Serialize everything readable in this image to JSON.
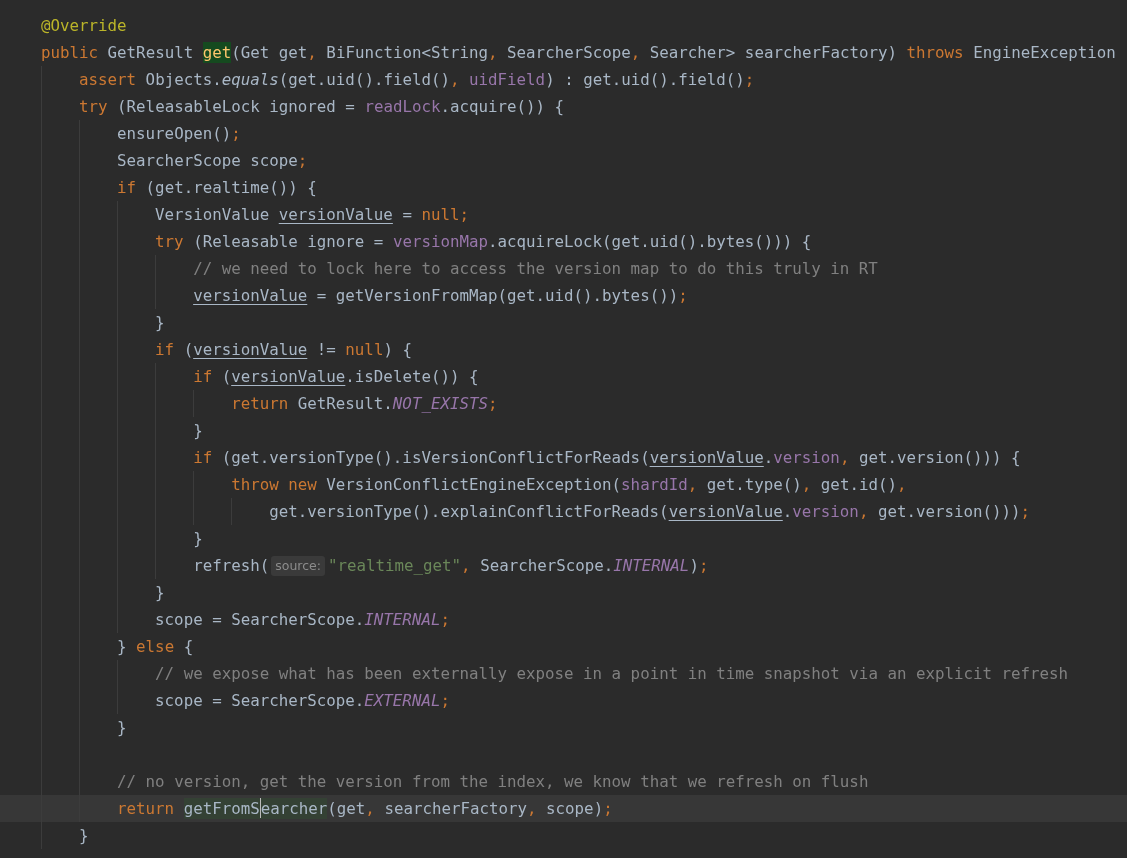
{
  "lines": [
    {
      "current": false,
      "tokens": [
        {
          "kind": "ann",
          "text": "@Override"
        }
      ]
    },
    {
      "current": false,
      "tokens": [
        {
          "kind": "kw",
          "text": "public"
        },
        {
          "kind": "plain",
          "text": " GetResult "
        },
        {
          "kind": "decl",
          "text": "get"
        },
        {
          "kind": "plain",
          "text": "(Get get"
        },
        {
          "kind": "punct",
          "text": ","
        },
        {
          "kind": "plain",
          "text": " BiFunction<String"
        },
        {
          "kind": "punct",
          "text": ","
        },
        {
          "kind": "plain",
          "text": " SearcherScope"
        },
        {
          "kind": "punct",
          "text": ","
        },
        {
          "kind": "plain",
          "text": " Searcher> searcherFactory) "
        },
        {
          "kind": "kw",
          "text": "throws"
        },
        {
          "kind": "plain",
          "text": " EngineException"
        }
      ],
      "children": [
        {
          "current": false,
          "tokens": [
            {
              "kind": "kw",
              "text": "assert"
            },
            {
              "kind": "plain",
              "text": " Objects."
            },
            {
              "kind": "italic",
              "text": "equals"
            },
            {
              "kind": "plain",
              "text": "(get.uid().field()"
            },
            {
              "kind": "punct",
              "text": ", "
            },
            {
              "kind": "field",
              "text": "uidField"
            },
            {
              "kind": "plain",
              "text": ") : get.uid().field()"
            },
            {
              "kind": "punct",
              "text": ";"
            }
          ]
        },
        {
          "current": false,
          "tokens": [
            {
              "kind": "kw",
              "text": "try"
            },
            {
              "kind": "plain",
              "text": " (ReleasableLock ignored = "
            },
            {
              "kind": "field",
              "text": "readLock"
            },
            {
              "kind": "plain",
              "text": ".acquire()) {"
            }
          ],
          "children": [
            {
              "current": false,
              "tokens": [
                {
                  "kind": "plain",
                  "text": "ensureOpen()"
                },
                {
                  "kind": "punct",
                  "text": ";"
                }
              ]
            },
            {
              "current": false,
              "tokens": [
                {
                  "kind": "plain",
                  "text": "SearcherScope scope"
                },
                {
                  "kind": "punct",
                  "text": ";"
                }
              ]
            },
            {
              "current": false,
              "tokens": [
                {
                  "kind": "kw",
                  "text": "if"
                },
                {
                  "kind": "plain",
                  "text": " (get.realtime()) {"
                }
              ],
              "children": [
                {
                  "current": false,
                  "tokens": [
                    {
                      "kind": "plain",
                      "text": "VersionValue "
                    },
                    {
                      "kind": "var",
                      "text": "versionValue"
                    },
                    {
                      "kind": "plain",
                      "text": " = "
                    },
                    {
                      "kind": "kw",
                      "text": "null"
                    },
                    {
                      "kind": "punct",
                      "text": ";"
                    }
                  ]
                },
                {
                  "current": false,
                  "tokens": [
                    {
                      "kind": "kw",
                      "text": "try"
                    },
                    {
                      "kind": "plain",
                      "text": " (Releasable ignore = "
                    },
                    {
                      "kind": "field",
                      "text": "versionMap"
                    },
                    {
                      "kind": "plain",
                      "text": ".acquireLock(get.uid().bytes())) {"
                    }
                  ],
                  "children": [
                    {
                      "current": false,
                      "tokens": [
                        {
                          "kind": "comment",
                          "text": "// we need to lock here to access the version map to do this truly in RT"
                        }
                      ]
                    },
                    {
                      "current": false,
                      "tokens": [
                        {
                          "kind": "var",
                          "text": "versionValue"
                        },
                        {
                          "kind": "plain",
                          "text": " = getVersionFromMap(get.uid().bytes())"
                        },
                        {
                          "kind": "punct",
                          "text": ";"
                        }
                      ]
                    }
                  ]
                },
                {
                  "current": false,
                  "tokens": [
                    {
                      "kind": "plain",
                      "text": "}"
                    }
                  ]
                },
                {
                  "current": false,
                  "tokens": [
                    {
                      "kind": "kw",
                      "text": "if"
                    },
                    {
                      "kind": "plain",
                      "text": " ("
                    },
                    {
                      "kind": "var",
                      "text": "versionValue"
                    },
                    {
                      "kind": "plain",
                      "text": " != "
                    },
                    {
                      "kind": "kw",
                      "text": "null"
                    },
                    {
                      "kind": "plain",
                      "text": ") {"
                    }
                  ],
                  "children": [
                    {
                      "current": false,
                      "tokens": [
                        {
                          "kind": "kw",
                          "text": "if"
                        },
                        {
                          "kind": "plain",
                          "text": " ("
                        },
                        {
                          "kind": "var",
                          "text": "versionValue"
                        },
                        {
                          "kind": "plain",
                          "text": ".isDelete()) {"
                        }
                      ],
                      "children": [
                        {
                          "current": false,
                          "tokens": [
                            {
                              "kind": "kw",
                              "text": "return"
                            },
                            {
                              "kind": "plain",
                              "text": " GetResult."
                            },
                            {
                              "kind": "const",
                              "text": "NOT_EXISTS"
                            },
                            {
                              "kind": "punct",
                              "text": ";"
                            }
                          ]
                        }
                      ]
                    },
                    {
                      "current": false,
                      "tokens": [
                        {
                          "kind": "plain",
                          "text": "}"
                        }
                      ]
                    },
                    {
                      "current": false,
                      "tokens": [
                        {
                          "kind": "kw",
                          "text": "if"
                        },
                        {
                          "kind": "plain",
                          "text": " (get.versionType().isVersionConflictForReads("
                        },
                        {
                          "kind": "var",
                          "text": "versionValue"
                        },
                        {
                          "kind": "plain",
                          "text": "."
                        },
                        {
                          "kind": "field",
                          "text": "version"
                        },
                        {
                          "kind": "punct",
                          "text": ","
                        },
                        {
                          "kind": "plain",
                          "text": " get.version())) {"
                        }
                      ],
                      "children": [
                        {
                          "current": false,
                          "tokens": [
                            {
                              "kind": "kw",
                              "text": "throw new"
                            },
                            {
                              "kind": "plain",
                              "text": " VersionConflictEngineException("
                            },
                            {
                              "kind": "field",
                              "text": "shardId"
                            },
                            {
                              "kind": "punct",
                              "text": ","
                            },
                            {
                              "kind": "plain",
                              "text": " get.type()"
                            },
                            {
                              "kind": "punct",
                              "text": ","
                            },
                            {
                              "kind": "plain",
                              "text": " get.id()"
                            },
                            {
                              "kind": "punct",
                              "text": ","
                            }
                          ],
                          "children": [
                            {
                              "current": false,
                              "tokens": [
                                {
                                  "kind": "plain",
                                  "text": "get.versionType().explainConflictForReads("
                                },
                                {
                                  "kind": "var",
                                  "text": "versionValue"
                                },
                                {
                                  "kind": "plain",
                                  "text": "."
                                },
                                {
                                  "kind": "field",
                                  "text": "version"
                                },
                                {
                                  "kind": "punct",
                                  "text": ","
                                },
                                {
                                  "kind": "plain",
                                  "text": " get.version()))"
                                },
                                {
                                  "kind": "punct",
                                  "text": ";"
                                }
                              ]
                            }
                          ]
                        }
                      ]
                    },
                    {
                      "current": false,
                      "tokens": [
                        {
                          "kind": "plain",
                          "text": "}"
                        }
                      ]
                    },
                    {
                      "current": false,
                      "tokens": [
                        {
                          "kind": "plain",
                          "text": "refresh("
                        },
                        {
                          "kind": "hint",
                          "text": "source:"
                        },
                        {
                          "kind": "string",
                          "text": "\"realtime_get\""
                        },
                        {
                          "kind": "punct",
                          "text": ","
                        },
                        {
                          "kind": "plain",
                          "text": " SearcherScope."
                        },
                        {
                          "kind": "const",
                          "text": "INTERNAL"
                        },
                        {
                          "kind": "plain",
                          "text": ")"
                        },
                        {
                          "kind": "punct",
                          "text": ";"
                        }
                      ]
                    }
                  ]
                },
                {
                  "current": false,
                  "tokens": [
                    {
                      "kind": "plain",
                      "text": "}"
                    }
                  ]
                },
                {
                  "current": false,
                  "tokens": [
                    {
                      "kind": "plain",
                      "text": "scope = SearcherScope."
                    },
                    {
                      "kind": "const",
                      "text": "INTERNAL"
                    },
                    {
                      "kind": "punct",
                      "text": ";"
                    }
                  ]
                }
              ]
            },
            {
              "current": false,
              "tokens": [
                {
                  "kind": "plain",
                  "text": "} "
                },
                {
                  "kind": "kw",
                  "text": "else"
                },
                {
                  "kind": "plain",
                  "text": " {"
                }
              ],
              "children": [
                {
                  "current": false,
                  "tokens": [
                    {
                      "kind": "comment",
                      "text": "// we expose what has been externally expose in a point in time snapshot via an explicit refresh"
                    }
                  ]
                },
                {
                  "current": false,
                  "tokens": [
                    {
                      "kind": "plain",
                      "text": "scope = SearcherScope."
                    },
                    {
                      "kind": "const",
                      "text": "EXTERNAL"
                    },
                    {
                      "kind": "punct",
                      "text": ";"
                    }
                  ]
                }
              ]
            },
            {
              "current": false,
              "tokens": [
                {
                  "kind": "plain",
                  "text": "}"
                }
              ]
            },
            {
              "current": false
            },
            {
              "current": false,
              "tokens": [
                {
                  "kind": "comment",
                  "text": "// no version, get the version from the index, we know that we refresh on flush"
                }
              ]
            },
            {
              "current": true,
              "tokens": [
                {
                  "kind": "kw",
                  "text": "return "
                },
                {
                  "kind": "match",
                  "text": "getFromS"
                },
                {
                  "kind": "caret"
                },
                {
                  "kind": "match",
                  "text": "earcher"
                },
                {
                  "kind": "plain",
                  "text": "(get"
                },
                {
                  "kind": "punct",
                  "text": ","
                },
                {
                  "kind": "plain",
                  "text": " searcherFactory"
                },
                {
                  "kind": "punct",
                  "text": ","
                },
                {
                  "kind": "plain",
                  "text": " scope)"
                },
                {
                  "kind": "punct",
                  "text": ";"
                }
              ]
            }
          ]
        },
        {
          "current": false,
          "tokens": [
            {
              "kind": "plain",
              "text": "}"
            }
          ]
        }
      ]
    }
  ]
}
